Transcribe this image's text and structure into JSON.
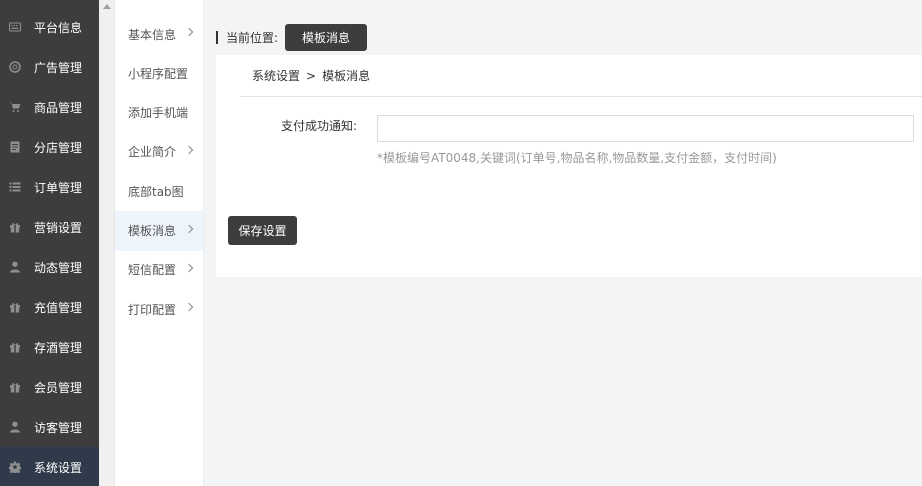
{
  "sidebar": {
    "items": [
      {
        "label": "平台信息",
        "icon": "keyboard-icon"
      },
      {
        "label": "广告管理",
        "icon": "lifebuoy-icon"
      },
      {
        "label": "商品管理",
        "icon": "cart-icon"
      },
      {
        "label": "分店管理",
        "icon": "document-icon"
      },
      {
        "label": "订单管理",
        "icon": "list-icon"
      },
      {
        "label": "营销设置",
        "icon": "gift-icon"
      },
      {
        "label": "动态管理",
        "icon": "user-icon"
      },
      {
        "label": "充值管理",
        "icon": "gift-icon"
      },
      {
        "label": "存酒管理",
        "icon": "gift-icon"
      },
      {
        "label": "会员管理",
        "icon": "gift-icon"
      },
      {
        "label": "访客管理",
        "icon": "user-icon"
      },
      {
        "label": "系统设置",
        "icon": "gear-icon"
      }
    ],
    "active_index": 11
  },
  "subnav": {
    "items": [
      {
        "label": "基本信息",
        "has_arrow": true
      },
      {
        "label": "小程序配置",
        "has_arrow": false
      },
      {
        "label": "添加手机端",
        "has_arrow": false
      },
      {
        "label": "企业简介",
        "has_arrow": true
      },
      {
        "label": "底部tab图",
        "has_arrow": false
      },
      {
        "label": "模板消息",
        "has_arrow": true
      },
      {
        "label": "短信配置",
        "has_arrow": true
      },
      {
        "label": "打印配置",
        "has_arrow": true
      }
    ],
    "active_index": 5
  },
  "breadcrumb": {
    "prefix": "当前位置:",
    "current": "模板消息"
  },
  "panel": {
    "path_parent": "系统设置",
    "path_sep": ">",
    "path_current": "模板消息",
    "field_label": "支付成功通知:",
    "field_value": "",
    "field_hint": "*模板编号AT0048,关键词(订单号,物品名称,物品数量,支付金额，支付时间)",
    "save_label": "保存设置"
  },
  "colors": {
    "sidebar_bg": "#3d3d3d",
    "sidebar_active": "#2f3b4a",
    "subnav_active": "#eef4fb",
    "button_bg": "#3d3d3d"
  }
}
